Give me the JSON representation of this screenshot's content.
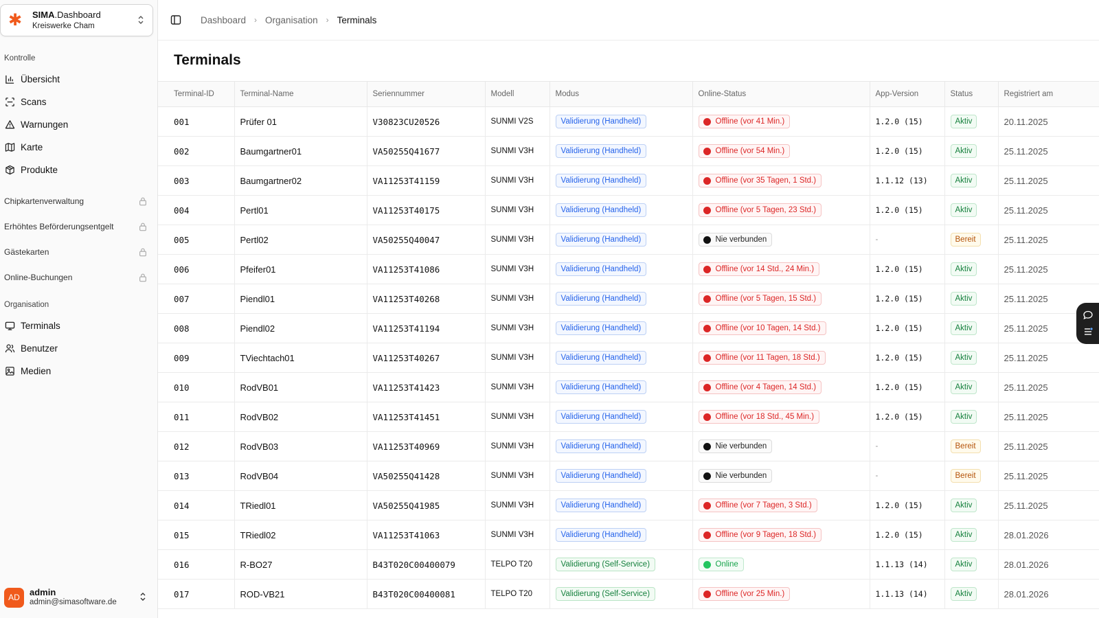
{
  "org": {
    "name_bold": "SIMA",
    "name_rest": ".Dashboard",
    "subtitle": "Kreiswerke Cham"
  },
  "sidebar": {
    "sections": {
      "kontrolle": "Kontrolle",
      "organisation": "Organisation"
    },
    "kontrolle_items": [
      {
        "label": "Übersicht",
        "icon": "bar-chart-icon"
      },
      {
        "label": "Scans",
        "icon": "scan-icon"
      },
      {
        "label": "Warnungen",
        "icon": "warning-icon"
      },
      {
        "label": "Karte",
        "icon": "map-icon"
      },
      {
        "label": "Produkte",
        "icon": "package-icon"
      }
    ],
    "locked_items": [
      {
        "label": "Chipkartenverwaltung"
      },
      {
        "label": "Erhöhtes Beförderungsentgelt"
      },
      {
        "label": "Gästekarten"
      },
      {
        "label": "Online-Buchungen"
      }
    ],
    "organisation_items": [
      {
        "label": "Terminals",
        "icon": "monitor-icon"
      },
      {
        "label": "Benutzer",
        "icon": "users-icon"
      },
      {
        "label": "Medien",
        "icon": "image-icon"
      }
    ]
  },
  "user": {
    "initials": "AD",
    "name": "admin",
    "email": "admin@simasoftware.de"
  },
  "breadcrumb": {
    "items": [
      "Dashboard",
      "Organisation",
      "Terminals"
    ]
  },
  "page": {
    "title": "Terminals"
  },
  "table": {
    "columns": [
      "Terminal-ID",
      "Terminal-Name",
      "Seriennummer",
      "Modell",
      "Modus",
      "Online-Status",
      "App-Version",
      "Status",
      "Registriert am"
    ],
    "rows": [
      {
        "id": "001",
        "name": "Prüfer 01",
        "serial": "V30823CU20526",
        "model": "SUNMI V2S",
        "mode": "Validierung (Handheld)",
        "mode_type": "hh",
        "online": "Offline (vor 41 Min.)",
        "online_type": "offline",
        "version": "1.2.0 (15)",
        "status": "Aktiv",
        "status_type": "aktiv",
        "registered": "20.11.2025"
      },
      {
        "id": "002",
        "name": "Baumgartner01",
        "serial": "VA50255Q41677",
        "model": "SUNMI V3H",
        "mode": "Validierung (Handheld)",
        "mode_type": "hh",
        "online": "Offline (vor 54 Min.)",
        "online_type": "offline",
        "version": "1.2.0 (15)",
        "status": "Aktiv",
        "status_type": "aktiv",
        "registered": "25.11.2025"
      },
      {
        "id": "003",
        "name": "Baumgartner02",
        "serial": "VA11253T41159",
        "model": "SUNMI V3H",
        "mode": "Validierung (Handheld)",
        "mode_type": "hh",
        "online": "Offline (vor 35 Tagen, 1 Std.)",
        "online_type": "offline",
        "version": "1.1.12 (13)",
        "status": "Aktiv",
        "status_type": "aktiv",
        "registered": "25.11.2025"
      },
      {
        "id": "004",
        "name": "Pertl01",
        "serial": "VA11253T40175",
        "model": "SUNMI V3H",
        "mode": "Validierung (Handheld)",
        "mode_type": "hh",
        "online": "Offline (vor 5 Tagen, 23 Std.)",
        "online_type": "offline",
        "version": "1.2.0 (15)",
        "status": "Aktiv",
        "status_type": "aktiv",
        "registered": "25.11.2025"
      },
      {
        "id": "005",
        "name": "Pertl02",
        "serial": "VA50255Q40047",
        "model": "SUNMI V3H",
        "mode": "Validierung (Handheld)",
        "mode_type": "hh",
        "online": "Nie verbunden",
        "online_type": "never",
        "version": "-",
        "status": "Bereit",
        "status_type": "bereit",
        "registered": "25.11.2025"
      },
      {
        "id": "006",
        "name": "Pfeifer01",
        "serial": "VA11253T41086",
        "model": "SUNMI V3H",
        "mode": "Validierung (Handheld)",
        "mode_type": "hh",
        "online": "Offline (vor 14 Std., 24 Min.)",
        "online_type": "offline",
        "version": "1.2.0 (15)",
        "status": "Aktiv",
        "status_type": "aktiv",
        "registered": "25.11.2025"
      },
      {
        "id": "007",
        "name": "Piendl01",
        "serial": "VA11253T40268",
        "model": "SUNMI V3H",
        "mode": "Validierung (Handheld)",
        "mode_type": "hh",
        "online": "Offline (vor 5 Tagen, 15 Std.)",
        "online_type": "offline",
        "version": "1.2.0 (15)",
        "status": "Aktiv",
        "status_type": "aktiv",
        "registered": "25.11.2025"
      },
      {
        "id": "008",
        "name": "Piendl02",
        "serial": "VA11253T41194",
        "model": "SUNMI V3H",
        "mode": "Validierung (Handheld)",
        "mode_type": "hh",
        "online": "Offline (vor 10 Tagen, 14 Std.)",
        "online_type": "offline",
        "version": "1.2.0 (15)",
        "status": "Aktiv",
        "status_type": "aktiv",
        "registered": "25.11.2025"
      },
      {
        "id": "009",
        "name": "TViechtach01",
        "serial": "VA11253T40267",
        "model": "SUNMI V3H",
        "mode": "Validierung (Handheld)",
        "mode_type": "hh",
        "online": "Offline (vor 11 Tagen, 18 Std.)",
        "online_type": "offline",
        "version": "1.2.0 (15)",
        "status": "Aktiv",
        "status_type": "aktiv",
        "registered": "25.11.2025"
      },
      {
        "id": "010",
        "name": "RodVB01",
        "serial": "VA11253T41423",
        "model": "SUNMI V3H",
        "mode": "Validierung (Handheld)",
        "mode_type": "hh",
        "online": "Offline (vor 4 Tagen, 14 Std.)",
        "online_type": "offline",
        "version": "1.2.0 (15)",
        "status": "Aktiv",
        "status_type": "aktiv",
        "registered": "25.11.2025"
      },
      {
        "id": "011",
        "name": "RodVB02",
        "serial": "VA11253T41451",
        "model": "SUNMI V3H",
        "mode": "Validierung (Handheld)",
        "mode_type": "hh",
        "online": "Offline (vor 18 Std., 45 Min.)",
        "online_type": "offline",
        "version": "1.2.0 (15)",
        "status": "Aktiv",
        "status_type": "aktiv",
        "registered": "25.11.2025"
      },
      {
        "id": "012",
        "name": "RodVB03",
        "serial": "VA11253T40969",
        "model": "SUNMI V3H",
        "mode": "Validierung (Handheld)",
        "mode_type": "hh",
        "online": "Nie verbunden",
        "online_type": "never",
        "version": "-",
        "status": "Bereit",
        "status_type": "bereit",
        "registered": "25.11.2025"
      },
      {
        "id": "013",
        "name": "RodVB04",
        "serial": "VA50255Q41428",
        "model": "SUNMI V3H",
        "mode": "Validierung (Handheld)",
        "mode_type": "hh",
        "online": "Nie verbunden",
        "online_type": "never",
        "version": "-",
        "status": "Bereit",
        "status_type": "bereit",
        "registered": "25.11.2025"
      },
      {
        "id": "014",
        "name": "TRiedl01",
        "serial": "VA50255Q41985",
        "model": "SUNMI V3H",
        "mode": "Validierung (Handheld)",
        "mode_type": "hh",
        "online": "Offline (vor 7 Tagen, 3 Std.)",
        "online_type": "offline",
        "version": "1.2.0 (15)",
        "status": "Aktiv",
        "status_type": "aktiv",
        "registered": "25.11.2025"
      },
      {
        "id": "015",
        "name": "TRiedl02",
        "serial": "VA11253T41063",
        "model": "SUNMI V3H",
        "mode": "Validierung (Handheld)",
        "mode_type": "hh",
        "online": "Offline (vor 9 Tagen, 18 Std.)",
        "online_type": "offline",
        "version": "1.2.0 (15)",
        "status": "Aktiv",
        "status_type": "aktiv",
        "registered": "28.01.2026"
      },
      {
        "id": "016",
        "name": "R-BO27",
        "serial": "B43T020C00400079",
        "model": "TELPO T20",
        "mode": "Validierung (Self-Service)",
        "mode_type": "ss",
        "online": "Online",
        "online_type": "online",
        "version": "1.1.13 (14)",
        "status": "Aktiv",
        "status_type": "aktiv",
        "registered": "28.01.2026"
      },
      {
        "id": "017",
        "name": "ROD-VB21",
        "serial": "B43T020C00400081",
        "model": "TELPO T20",
        "mode": "Validierung (Self-Service)",
        "mode_type": "ss",
        "online": "Offline (vor 25 Min.)",
        "online_type": "offline",
        "version": "1.1.13 (14)",
        "status": "Aktiv",
        "status_type": "aktiv",
        "registered": "28.01.2026"
      }
    ]
  },
  "colors": {
    "brand": "#f05a1c",
    "offline": "#dc2626",
    "online": "#22c55e",
    "mode_blue": "#2563eb",
    "aktiv": "#15803d",
    "bereit": "#b45309"
  }
}
